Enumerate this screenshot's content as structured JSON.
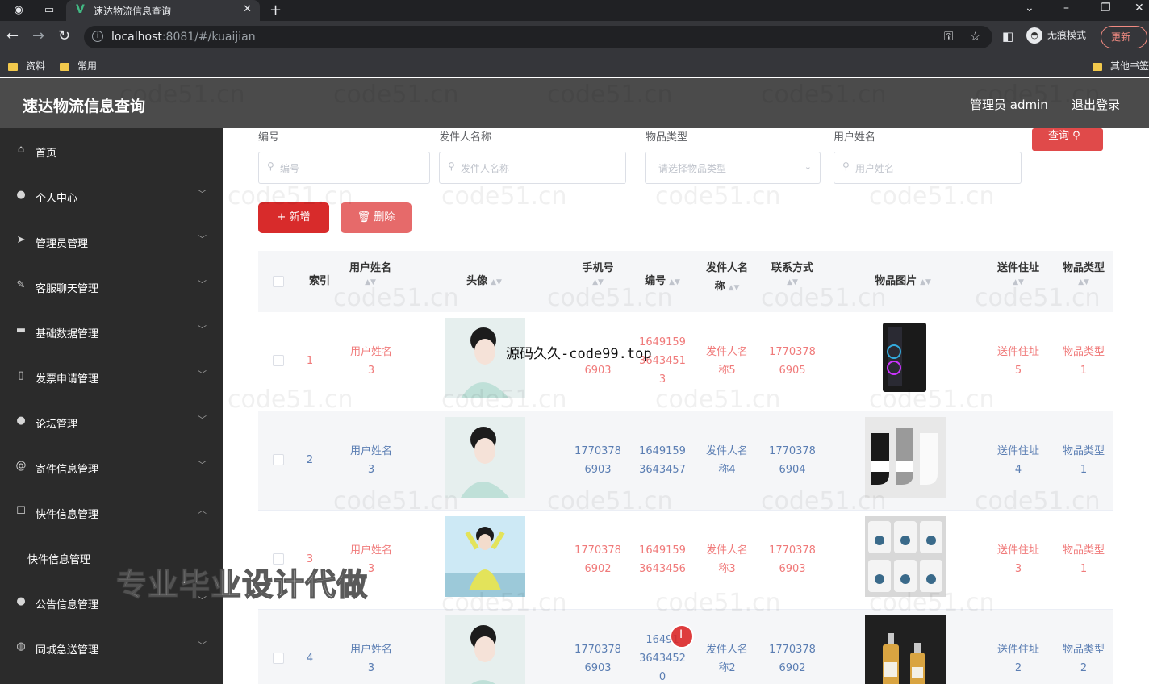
{
  "browser": {
    "tab_title": "速达物流信息查询",
    "url_host": "localhost",
    "url_rest": ":8081/#/kuaijian",
    "incognito_label": "无痕模式",
    "update_label": "更新",
    "bookmarks": [
      "资料",
      "常用"
    ],
    "other_bookmarks": "其他书签"
  },
  "header": {
    "title": "速达物流信息查询",
    "admin": "管理员 admin",
    "logout": "退出登录"
  },
  "sidebar": {
    "items": [
      {
        "label": "首页",
        "icon": "home-icon"
      },
      {
        "label": "个人中心",
        "icon": "user-icon"
      },
      {
        "label": "管理员管理",
        "icon": "send-icon"
      },
      {
        "label": "客服聊天管理",
        "icon": "edit-icon"
      },
      {
        "label": "基础数据管理",
        "icon": "data-icon"
      },
      {
        "label": "发票申请管理",
        "icon": "receipt-icon"
      },
      {
        "label": "论坛管理",
        "icon": "user-icon"
      },
      {
        "label": "寄件信息管理",
        "icon": "at-icon"
      },
      {
        "label": "快件信息管理",
        "icon": "box-icon"
      },
      {
        "label": "公告信息管理",
        "icon": "bulb-icon"
      },
      {
        "label": "同城急送管理",
        "icon": "globe-icon"
      }
    ],
    "submenu_label": "快件信息管理"
  },
  "search": {
    "fields": [
      {
        "label": "编号",
        "placeholder": "编号"
      },
      {
        "label": "发件人名称",
        "placeholder": "发件人名称"
      },
      {
        "label": "物品类型",
        "placeholder": "请选择物品类型"
      },
      {
        "label": "用户姓名",
        "placeholder": "用户姓名"
      }
    ],
    "query_label": "查询"
  },
  "actions": {
    "add_label": "新增",
    "delete_label": "删除"
  },
  "table": {
    "headers": {
      "index": "索引",
      "username": "用户姓名",
      "avatar": "头像",
      "phone": "手机号",
      "code": "编号",
      "sender_l1": "发件人名",
      "sender_l2": "称",
      "contact": "联系方式",
      "item_image": "物品图片",
      "address": "送件住址",
      "item_type": "物品类型"
    },
    "rows": [
      {
        "index": "1",
        "username": [
          "用户姓名",
          "3"
        ],
        "phone": [
          "",
          "6903"
        ],
        "code": [
          "1649159",
          "3643451",
          "3"
        ],
        "sender": [
          "发件人名",
          "称5"
        ],
        "contact": [
          "1770378",
          "6905"
        ],
        "address": [
          "送件住址",
          "5"
        ],
        "type": [
          "物品类型",
          "1"
        ],
        "color": "red"
      },
      {
        "index": "2",
        "username": [
          "用户姓名",
          "3"
        ],
        "phone": [
          "1770378",
          "6903"
        ],
        "code": [
          "1649159",
          "3643457"
        ],
        "sender": [
          "发件人名",
          "称4"
        ],
        "contact": [
          "1770378",
          "6904"
        ],
        "address": [
          "送件住址",
          "4"
        ],
        "type": [
          "物品类型",
          "1"
        ],
        "color": "blue"
      },
      {
        "index": "3",
        "username": [
          "用户姓名",
          "3"
        ],
        "phone": [
          "1770378",
          "6902"
        ],
        "code": [
          "1649159",
          "3643456"
        ],
        "sender": [
          "发件人名",
          "称3"
        ],
        "contact": [
          "1770378",
          "6903"
        ],
        "address": [
          "送件住址",
          "3"
        ],
        "type": [
          "物品类型",
          "1"
        ],
        "color": "red"
      },
      {
        "index": "4",
        "username": [
          "用户姓名",
          "3"
        ],
        "phone": [
          "1770378",
          "6903"
        ],
        "code": [
          "16491",
          "3643452",
          "0"
        ],
        "sender": [
          "发件人名",
          "称2"
        ],
        "contact": [
          "1770378",
          "6902"
        ],
        "address": [
          "送件住址",
          "2"
        ],
        "type": [
          "物品类型",
          "2"
        ],
        "color": "blue"
      }
    ]
  },
  "overlays": {
    "source_text": "源码久久-code99.top",
    "promo_text": "专业毕业设计代做",
    "watermark": "code51.cn",
    "cursor_label": "I"
  }
}
